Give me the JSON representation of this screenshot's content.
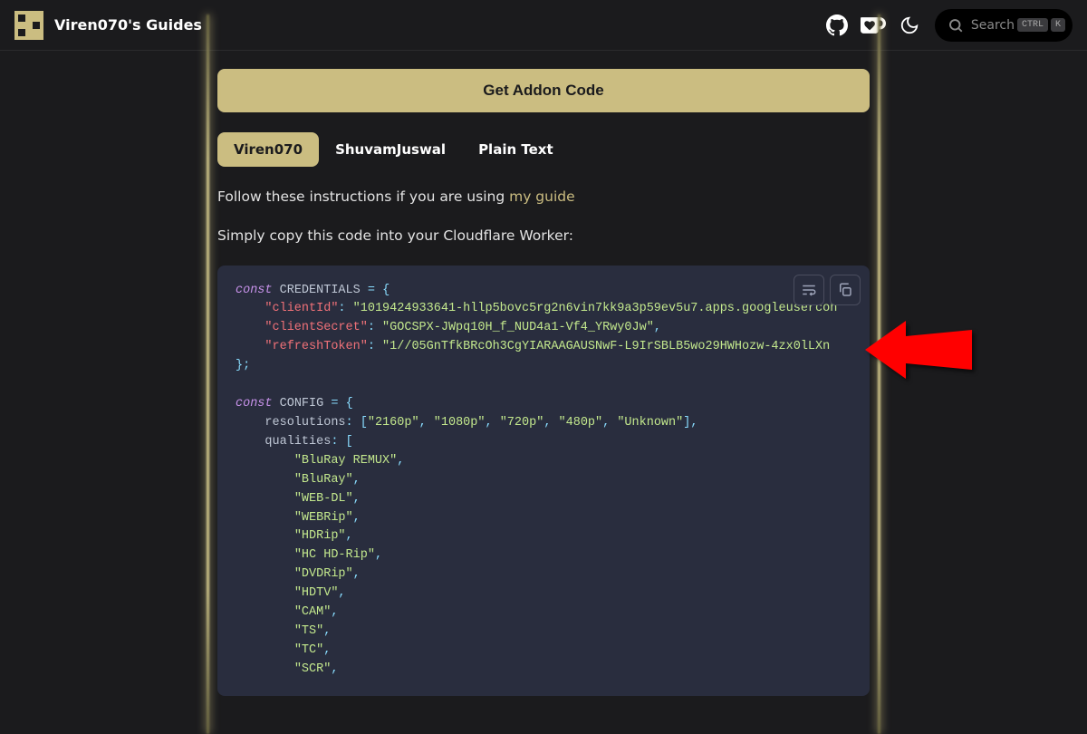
{
  "header": {
    "siteTitle": "Viren070's Guides",
    "searchPlaceholder": "Search",
    "kbd1": "CTRL",
    "kbd2": "K"
  },
  "button": {
    "getAddonCode": "Get Addon Code"
  },
  "tabs": [
    {
      "label": "Viren070",
      "active": true
    },
    {
      "label": "ShuvamJuswal",
      "active": false
    },
    {
      "label": "Plain Text",
      "active": false
    }
  ],
  "para1_pre": "Follow these instructions if you are using ",
  "para1_link": "my guide",
  "para2": "Simply copy this code into your Cloudflare Worker:",
  "code": {
    "credentialsVar": "CREDENTIALS",
    "clientIdKey": "\"clientId\"",
    "clientIdVal": "\"1019424933641-hllp5bovc5rg2n6vin7kk9a3p59ev5u7.apps.googleusercon",
    "clientSecretKey": "\"clientSecret\"",
    "clientSecretVal": "\"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\"",
    "refreshTokenKey": "\"refreshToken\"",
    "refreshTokenVal": "\"1//05GnTfkBRcOh3CgYIARAAGAUSNwF-L9IrSBLB5wo29HWHozw-4zx0lLXn",
    "configVar": "CONFIG",
    "resolutionsKey": "resolutions",
    "resolutions": [
      "\"2160p\"",
      "\"1080p\"",
      "\"720p\"",
      "\"480p\"",
      "\"Unknown\""
    ],
    "qualitiesKey": "qualities",
    "qualities": [
      "\"BluRay REMUX\"",
      "\"BluRay\"",
      "\"WEB-DL\"",
      "\"WEBRip\"",
      "\"HDRip\"",
      "\"HC HD-Rip\"",
      "\"DVDRip\"",
      "\"HDTV\"",
      "\"CAM\"",
      "\"TS\"",
      "\"TC\"",
      "\"SCR\""
    ]
  }
}
